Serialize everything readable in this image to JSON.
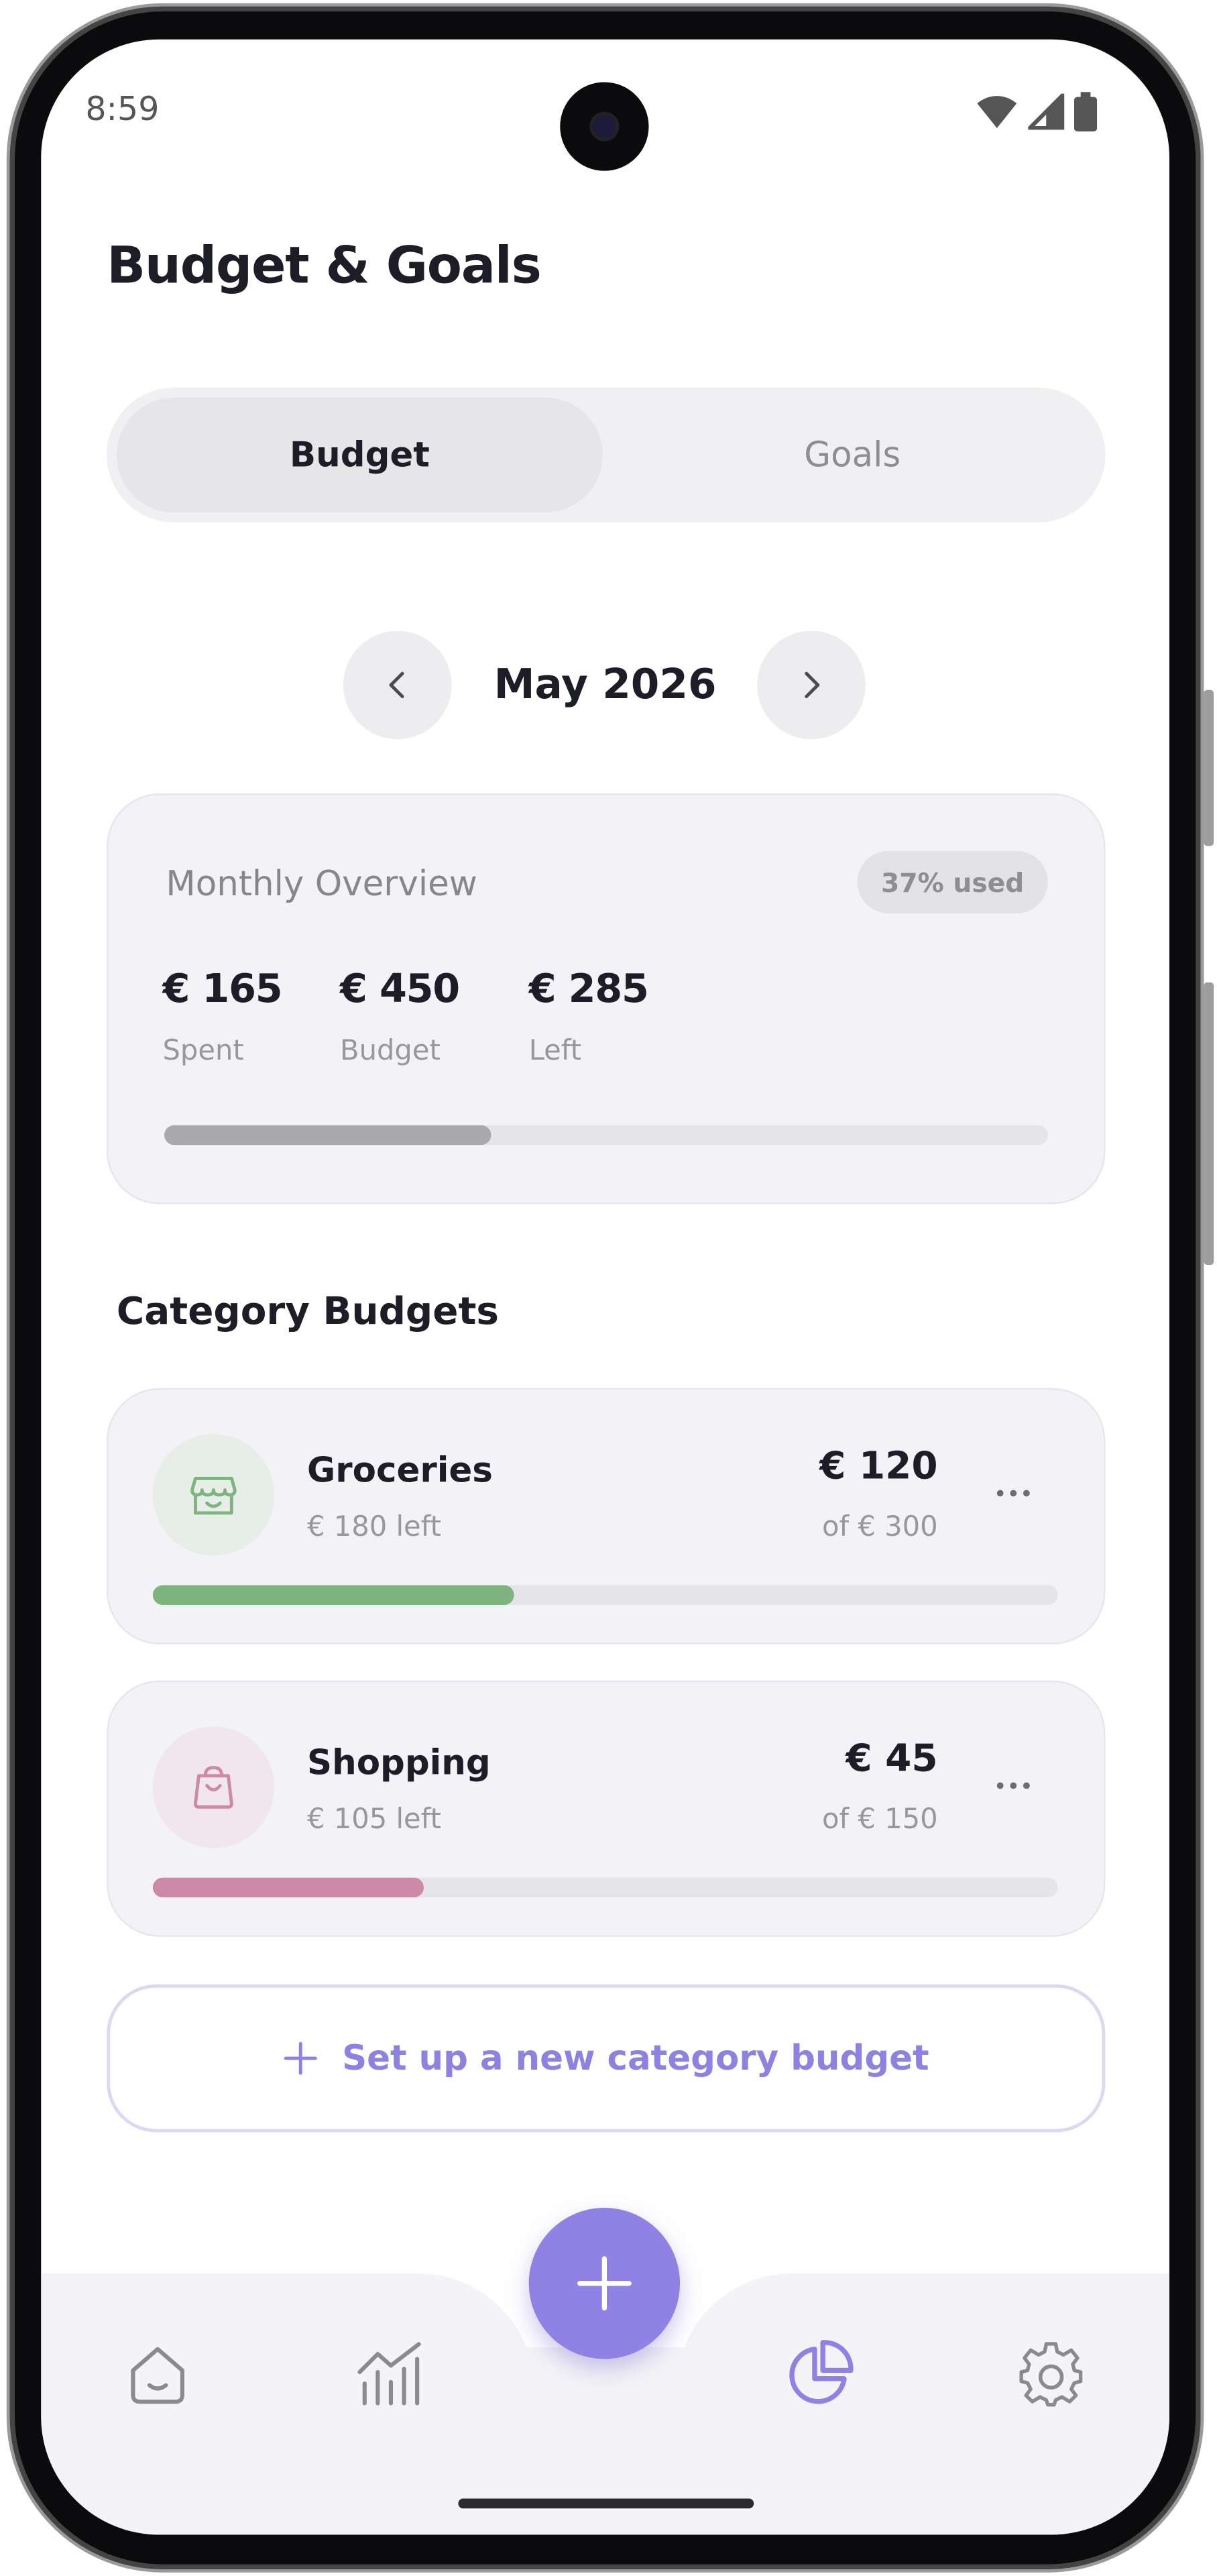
{
  "status_bar": {
    "time": "8:59"
  },
  "header": {
    "title": "Budget & Goals"
  },
  "tabs": [
    {
      "label": "Budget",
      "active": true
    },
    {
      "label": "Goals",
      "active": false
    }
  ],
  "month_nav": {
    "label": "May 2026"
  },
  "overview": {
    "title": "Monthly Overview",
    "badge": "37% used",
    "stats": [
      {
        "value": "€ 165",
        "label": "Spent"
      },
      {
        "value": "€ 450",
        "label": "Budget"
      },
      {
        "value": "€ 285",
        "label": "Left"
      }
    ],
    "progress": 0.37,
    "progress_color": "#a9a9ad"
  },
  "section_title": "Category Budgets",
  "categories": [
    {
      "name": "Groceries",
      "left": "€ 180 left",
      "spent": "€ 120",
      "of": "of € 300",
      "progress": 0.4,
      "color": "#7fb37f",
      "icon_bg": "#e6eee7",
      "icon": "store-icon"
    },
    {
      "name": "Shopping",
      "left": "€ 105 left",
      "spent": "€ 45",
      "of": "of € 150",
      "progress": 0.3,
      "color": "#cc8aa6",
      "icon_bg": "#f1e6ec",
      "icon": "shopping-bag-icon"
    }
  ],
  "new_category": {
    "label": "Set up a new category budget"
  },
  "colors": {
    "accent": "#8f82e4",
    "text": "#1d1d28"
  },
  "bottom_nav": [
    "home-icon",
    "chart-icon",
    "pie-chart-icon",
    "settings-icon"
  ]
}
